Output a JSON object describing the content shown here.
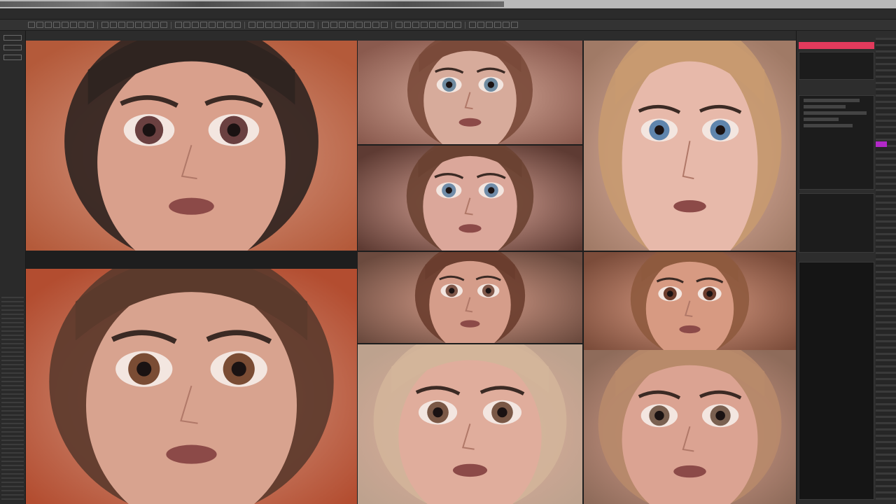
{
  "app": {
    "menu_items": [],
    "watermark": ""
  },
  "canvas": {
    "tiles": [
      {
        "id": "face-1",
        "hair": "#2f2420",
        "skin": "#d9a08c",
        "bg": "#b45a3a",
        "eyes": "#6a4040"
      },
      {
        "id": "face-2",
        "hair": "#7a4a3a",
        "skin": "#d7ab9b",
        "bg": "#8a5a4e",
        "eyes": "#6f8ba0"
      },
      {
        "id": "face-3",
        "hair": "#6b4232",
        "skin": "#dba79a",
        "bg": "#5e3b33",
        "eyes": "#708ca8"
      },
      {
        "id": "face-4",
        "hair": "#c89a70",
        "skin": "#e7b9aa",
        "bg": "#a07a66",
        "eyes": "#5f85ad"
      },
      {
        "id": "face-5",
        "hair": "#5b3a2c",
        "skin": "#d8a38f",
        "bg": "#b34d30",
        "eyes": "#7a4c34"
      },
      {
        "id": "face-6",
        "hair": "#6a3d2e",
        "skin": "#d59d8a",
        "bg": "#6b4a3e",
        "eyes": "#80584a"
      },
      {
        "id": "face-7",
        "hair": "#8e5a3e",
        "skin": "#d79a82",
        "bg": "#7b4c3a",
        "eyes": "#6d3d2d"
      },
      {
        "id": "face-8",
        "hair": "#d3b59a",
        "skin": "#e0ad9c",
        "bg": "#bda28e",
        "eyes": "#7a5846"
      },
      {
        "id": "face-9",
        "hair": "#b88a6a",
        "skin": "#dba392",
        "bg": "#8e6b5a",
        "eyes": "#7a6050"
      }
    ]
  },
  "colors": {
    "accent": "#e23a5c",
    "highlight": "#b228c8"
  }
}
